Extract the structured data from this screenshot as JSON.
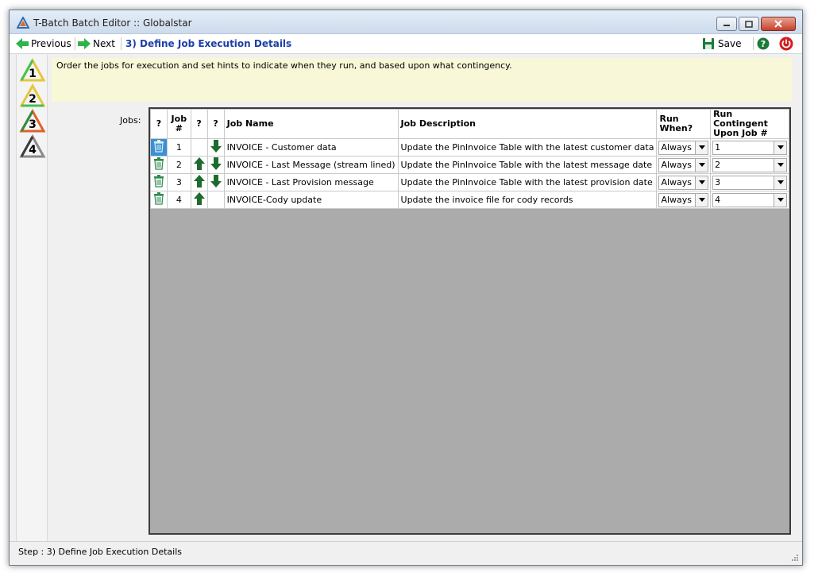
{
  "window": {
    "title": "T-Batch Batch Editor :: Globalstar"
  },
  "toolbar": {
    "previous_label": "Previous",
    "next_label": "Next",
    "step_title": "3) Define Job Execution Details",
    "save_label": "Save"
  },
  "sidebar": {
    "steps": [
      "1",
      "2",
      "3",
      "4"
    ]
  },
  "hint_text": "Order the jobs for execution and set hints to indicate when they run, and based upon what contingency.",
  "jobs_label": "Jobs:",
  "table": {
    "headers": {
      "q1": "?",
      "job_num": "Job #",
      "q2": "?",
      "q3": "?",
      "job_name": "Job Name",
      "job_description": "Job Description",
      "run_when": "Run When?",
      "run_contingent": "Run Contingent Upon Job #"
    },
    "rows": [
      {
        "job": "1",
        "name": "INVOICE - Customer data",
        "description": "Update the PinInvoice Table with the latest customer data",
        "run_when": "Always",
        "contingent": "1"
      },
      {
        "job": "2",
        "name": "INVOICE - Last Message (stream lined)",
        "description": "Update the PinInvoice Table with the latest message date",
        "run_when": "Always",
        "contingent": "2"
      },
      {
        "job": "3",
        "name": "INVOICE - Last Provision message",
        "description": "Update the PinInvoice Table with the latest provision date",
        "run_when": "Always",
        "contingent": "3"
      },
      {
        "job": "4",
        "name": "INVOICE-Cody update",
        "description": "Update the invoice file for cody records",
        "run_when": "Always",
        "contingent": "4"
      }
    ]
  },
  "status": {
    "text": "Step : 3) Define Job Execution Details"
  },
  "colors": {
    "accent_blue": "#1c3fa8",
    "arrow_green": "#1e6b2e",
    "hint_bg": "#f8f8d8",
    "grid_bg": "#ababab"
  }
}
